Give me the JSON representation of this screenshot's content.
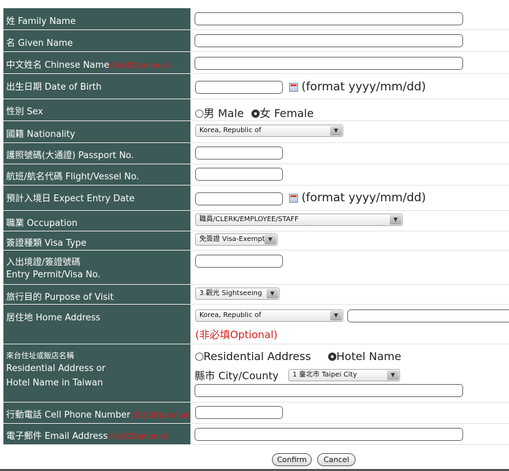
{
  "fields": {
    "family_name": {
      "label": "姓 Family Name",
      "value": ""
    },
    "given_name": {
      "label": "名 Given Name",
      "value": ""
    },
    "chinese_name": {
      "label": "中文姓名 Chinese Name",
      "optional": "(非必填Optional)",
      "value": ""
    },
    "dob": {
      "label": "出生日期 Date of Birth",
      "value": "",
      "format": "(format yyyy/mm/dd)"
    },
    "sex": {
      "label": "性別 Sex",
      "male": "男 Male",
      "female": "女 Female",
      "selected": "female"
    },
    "nationality": {
      "label": "國籍 Nationality",
      "value": "Korea, Republic of"
    },
    "passport": {
      "label": "護照號碼(大通證) Passport No.",
      "value": ""
    },
    "flight": {
      "label": "航班/航名代碼 Flight/Vessel No.",
      "value": ""
    },
    "entry_date": {
      "label": "預計入境日 Expect Entry Date",
      "value": "",
      "format": "(format yyyy/mm/dd)"
    },
    "occupation": {
      "label": "職業 Occupation",
      "value": "職員/CLERK/EMPLOYEE/STAFF"
    },
    "visa_type": {
      "label": "簽證種類 Visa Type",
      "value": "免簽證 Visa-Exempt"
    },
    "entry_permit": {
      "label_line1": "入出境證/簽證號碼",
      "label_line2": "Entry Permit/Visa No.",
      "value": ""
    },
    "purpose": {
      "label": "旅行目的 Purpose of Visit",
      "value": "3.觀光 Sightseeing"
    },
    "home_address": {
      "label": "居住地 Home Address",
      "country": "Korea, Republic of",
      "value": "",
      "optional": "(非必填Optional)"
    },
    "taiwan_address": {
      "label_line1": "來台住址或飯店名稱",
      "label_line2": "Residential Address or",
      "label_line3": "Hotel Name in Taiwan",
      "residential": "Residential Address",
      "hotel": "Hotel Name",
      "selected": "hotel",
      "city_label": "縣市 City/County",
      "city_value": "1 臺北市 Taipei City",
      "value": ""
    },
    "cell_phone": {
      "label": "行動電話 Cell Phone Number",
      "optional": "(非必填Optional)",
      "value": ""
    },
    "email": {
      "label": "電子郵件 Email Address",
      "optional": "(非必填Optional)",
      "value": ""
    }
  },
  "buttons": {
    "confirm": "Confirm",
    "cancel": "Cancel"
  },
  "colors": {
    "label_bg": "#3c5a57",
    "optional_text": "#d82020"
  }
}
